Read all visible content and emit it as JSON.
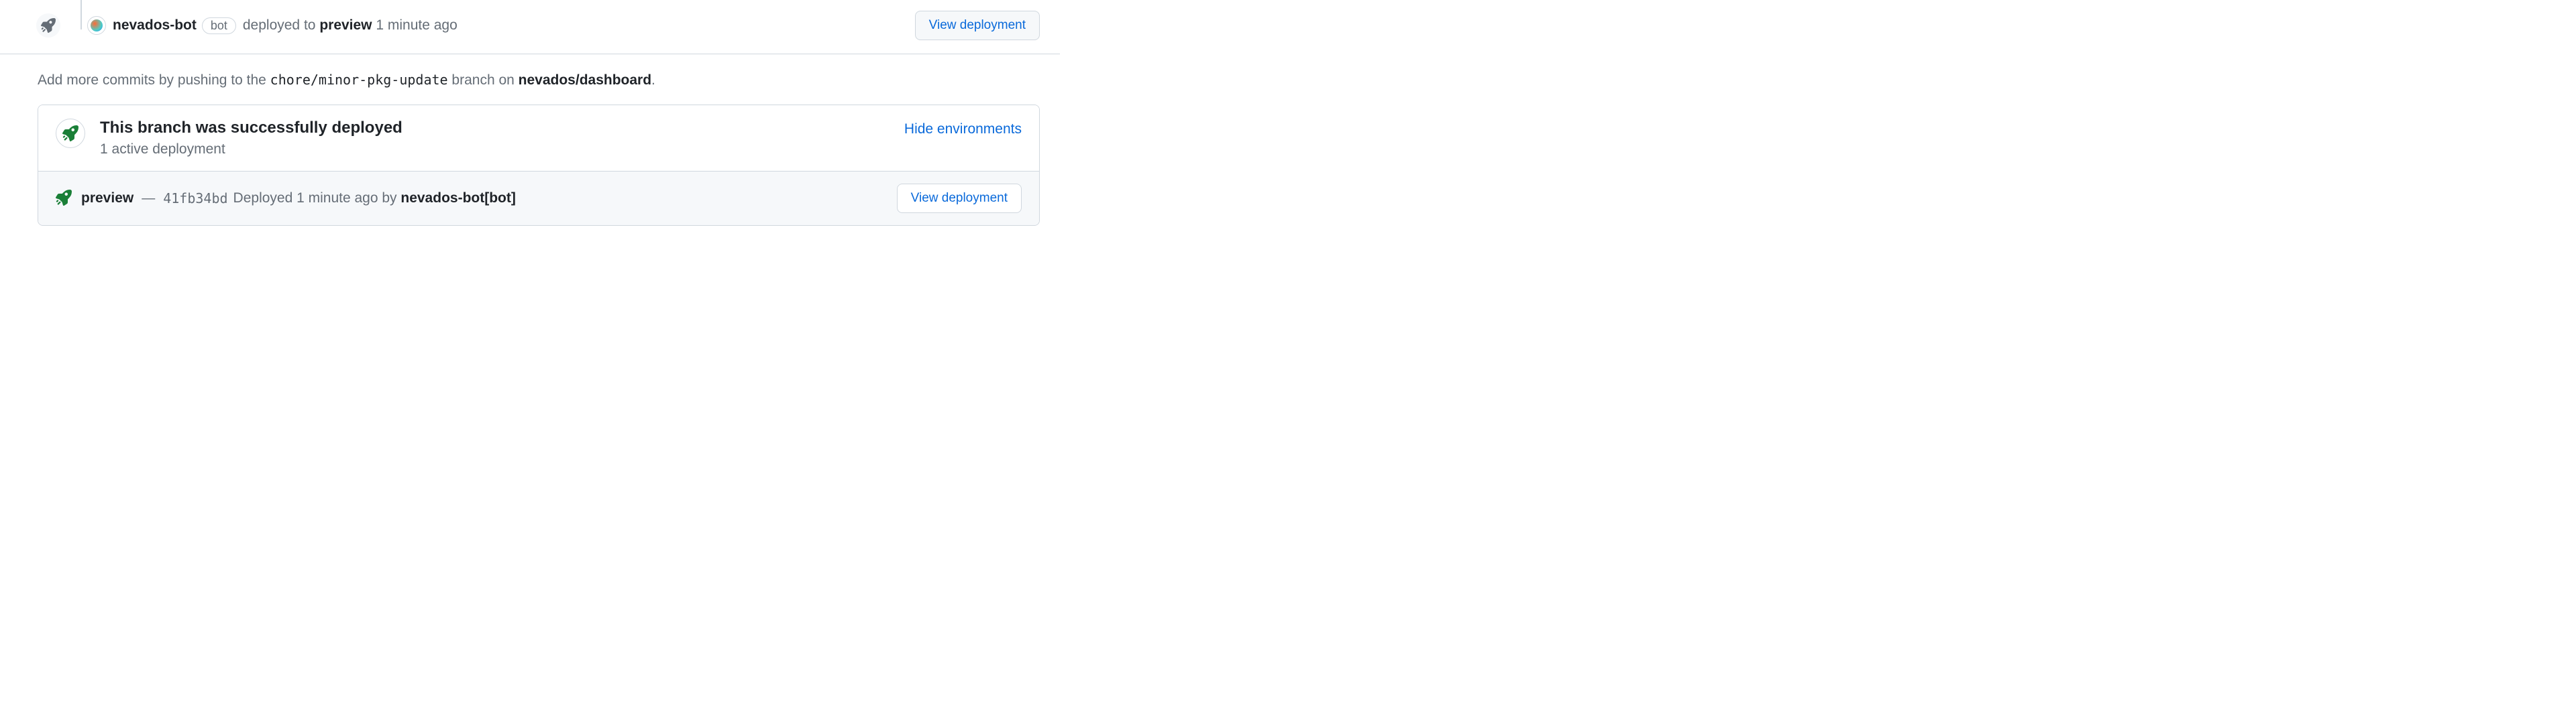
{
  "timeline_event": {
    "actor": "nevados-bot",
    "bot_label": "bot",
    "action_prefix": "deployed to ",
    "environment": "preview",
    "timestamp": " 1 minute ago",
    "view_button": "View deployment"
  },
  "push_hint": {
    "prefix": "Add more commits by pushing to the ",
    "branch": "chore/minor-pkg-update",
    "mid": " branch on ",
    "repo": "nevados/dashboard",
    "suffix": "."
  },
  "deploy_box": {
    "title": "This branch was successfully deployed",
    "subtitle": "1 active deployment",
    "hide_link": "Hide environments",
    "row": {
      "env": "preview",
      "sep": "—",
      "sha": "41fb34bd",
      "meta_prefix": " Deployed 1 minute ago by ",
      "actor": "nevados-bot[bot]",
      "view_button": "View deployment"
    }
  }
}
